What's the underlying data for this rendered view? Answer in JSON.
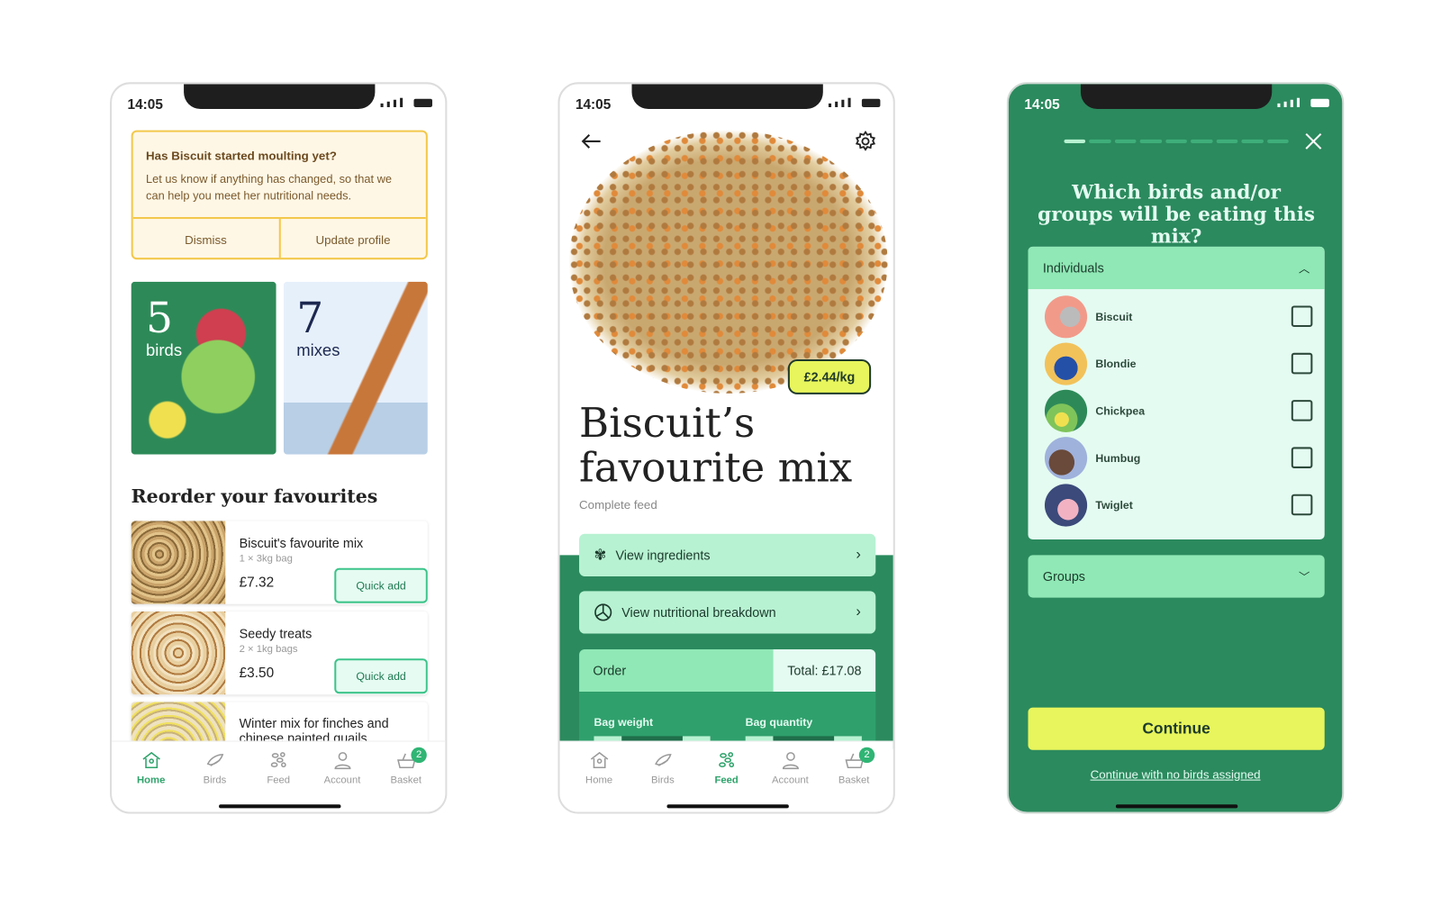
{
  "status": {
    "time": "14:05"
  },
  "tabs": [
    {
      "label": "Home",
      "icon": "home-icon"
    },
    {
      "label": "Birds",
      "icon": "bird-icon"
    },
    {
      "label": "Feed",
      "icon": "seeds-icon"
    },
    {
      "label": "Account",
      "icon": "user-icon"
    },
    {
      "label": "Basket",
      "icon": "basket-icon"
    }
  ],
  "basket_count": "2",
  "home": {
    "alert": {
      "title": "Has Biscuit started moulting yet?",
      "body": "Let us know if anything has changed, so that we can help you meet her nutritional needs.",
      "dismiss": "Dismiss",
      "update": "Update profile"
    },
    "tiles": [
      {
        "number": "5",
        "label": "birds"
      },
      {
        "number": "7",
        "label": "mixes"
      }
    ],
    "section_title": "Reorder your favourites",
    "items": [
      {
        "name": "Biscuit's favourite mix",
        "size": "1 × 3kg bag",
        "price": "£7.32",
        "action": "Quick add"
      },
      {
        "name": "Seedy treats",
        "size": "2 × 1kg bags",
        "price": "£3.50",
        "action": "Quick add"
      },
      {
        "name": "Winter mix for finches and chinese painted quails"
      }
    ],
    "active_tab": "Home"
  },
  "product": {
    "price_per_kg": "£2.44/kg",
    "title_line1": "Biscuit’s",
    "title_line2": "favourite mix",
    "subtitle": "Complete feed",
    "view_ingredients": "View ingredients",
    "view_nutrition": "View nutritional breakdown",
    "order_label": "Order",
    "total": "Total: £17.08",
    "bag_weight": "Bag weight",
    "bag_quantity": "Bag quantity",
    "active_tab": "Feed"
  },
  "picker": {
    "progress": {
      "step": 1,
      "total": 9
    },
    "question": "Which birds and/or groups will be eating this mix?",
    "individuals_label": "Individuals",
    "birds": [
      {
        "name": "Biscuit",
        "checked": false
      },
      {
        "name": "Blondie",
        "checked": false
      },
      {
        "name": "Chickpea",
        "checked": false
      },
      {
        "name": "Humbug",
        "checked": false
      },
      {
        "name": "Twiglet",
        "checked": false
      }
    ],
    "groups_label": "Groups",
    "continue": "Continue",
    "skip": "Continue with no birds assigned"
  },
  "colors": {
    "brand_green": "#2b8a5e",
    "mint": "#b7f2d2",
    "accent_yellow": "#e8f55c",
    "alert_border": "#f3c84b"
  }
}
